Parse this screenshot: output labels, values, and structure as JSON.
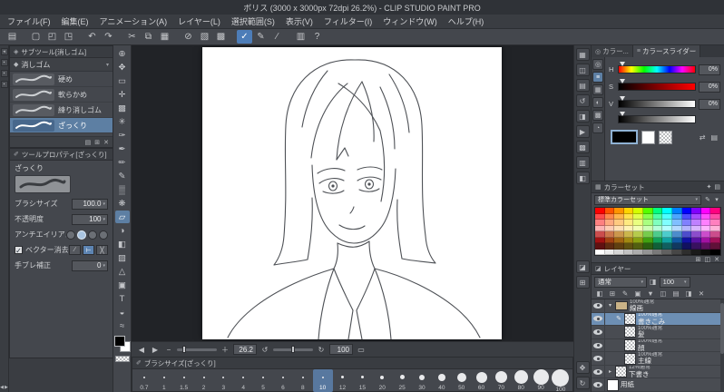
{
  "window": {
    "title": "ボリス (3000 x 3000px 72dpi 26.2%) - CLIP STUDIO PAINT PRO"
  },
  "menu": {
    "items": [
      "ファイル(F)",
      "編集(E)",
      "アニメーション(A)",
      "レイヤー(L)",
      "選択範囲(S)",
      "表示(V)",
      "フィルター(I)",
      "ウィンドウ(W)",
      "ヘルプ(H)"
    ]
  },
  "toolbar": {
    "icons": [
      {
        "name": "panel-layout-icon",
        "glyph": "▤"
      },
      {
        "sep": true
      },
      {
        "name": "new-file-icon",
        "glyph": "▢"
      },
      {
        "name": "open-file-icon",
        "glyph": "◰"
      },
      {
        "name": "save-file-icon",
        "glyph": "◳"
      },
      {
        "sep": true
      },
      {
        "name": "undo-icon",
        "glyph": "↶"
      },
      {
        "name": "redo-icon",
        "glyph": "↷"
      },
      {
        "sep": true
      },
      {
        "name": "cut-icon",
        "glyph": "✂"
      },
      {
        "name": "copy-icon",
        "glyph": "⧉"
      },
      {
        "name": "paste-icon",
        "glyph": "▦"
      },
      {
        "sep": true
      },
      {
        "name": "deselect-icon",
        "glyph": "⊘"
      },
      {
        "name": "invert-selection-icon",
        "glyph": "▧"
      },
      {
        "name": "selection-border-icon",
        "glyph": "▩"
      },
      {
        "sep": true
      },
      {
        "name": "snap-ruler-icon",
        "glyph": "✓",
        "active": true
      },
      {
        "name": "pen-pressure-icon",
        "glyph": "✎"
      },
      {
        "name": "vector-snap-icon",
        "glyph": "∕"
      },
      {
        "sep": true
      },
      {
        "name": "grid-view-icon",
        "glyph": "▥"
      },
      {
        "name": "help-icon",
        "glyph": "?"
      }
    ]
  },
  "left_strip": {
    "icons": [
      {
        "name": "collapse-left-dock-icon",
        "glyph": "◂"
      },
      {
        "name": "workspace-slot-icon-1",
        "glyph": "▪"
      },
      {
        "name": "workspace-slot-icon-2",
        "glyph": "▪"
      },
      {
        "name": "workspace-slot-icon-3",
        "glyph": "▪"
      }
    ],
    "bottom_icons": [
      {
        "name": "scroll-left-icon",
        "glyph": "◀"
      },
      {
        "name": "scroll-right-icon",
        "glyph": "▶"
      }
    ]
  },
  "tools": {
    "fg_color": "#000000",
    "bg_color": "#ffffff",
    "icons": [
      {
        "name": "zoom-tool-icon",
        "glyph": "⊕"
      },
      {
        "name": "move-tool-icon",
        "glyph": "✥"
      },
      {
        "name": "operation-tool-icon",
        "glyph": "▭"
      },
      {
        "name": "layer-move-tool-icon",
        "glyph": "✛"
      },
      {
        "name": "selection-tool-icon",
        "glyph": "▩"
      },
      {
        "name": "auto-select-tool-icon",
        "glyph": "✳"
      },
      {
        "name": "eyedropper-tool-icon",
        "glyph": "✑"
      },
      {
        "name": "pen-tool-icon",
        "glyph": "✒"
      },
      {
        "name": "pencil-tool-icon",
        "glyph": "✏"
      },
      {
        "name": "brush-tool-icon",
        "glyph": "✎"
      },
      {
        "name": "airbrush-tool-icon",
        "glyph": "▒"
      },
      {
        "name": "decoration-tool-icon",
        "glyph": "❋"
      },
      {
        "name": "eraser-tool-icon",
        "glyph": "▱",
        "selected": true
      },
      {
        "name": "blend-tool-icon",
        "glyph": "◑"
      },
      {
        "name": "fill-tool-icon",
        "glyph": "◧"
      },
      {
        "name": "gradient-tool-icon",
        "glyph": "▨"
      },
      {
        "name": "figure-tool-icon",
        "glyph": "△"
      },
      {
        "name": "frame-tool-icon",
        "glyph": "▣"
      },
      {
        "name": "text-tool-icon",
        "glyph": "T"
      },
      {
        "name": "balloon-tool-icon",
        "glyph": "◒"
      },
      {
        "name": "line-correct-tool-icon",
        "glyph": "≈"
      }
    ]
  },
  "subtool": {
    "icon": "◈",
    "title": "サブツール[消しゴム]",
    "group_label": "消しゴム",
    "items": [
      {
        "label": "硬め"
      },
      {
        "label": "軟らかめ"
      },
      {
        "label": "練り消しゴム"
      },
      {
        "label": "ざっくり",
        "selected": true
      }
    ],
    "footer_icons": [
      {
        "name": "subtool-detail-icon",
        "glyph": "▤"
      },
      {
        "name": "add-subtool-icon",
        "glyph": "⊞"
      },
      {
        "name": "delete-subtool-icon",
        "glyph": "✕"
      }
    ]
  },
  "tool_property": {
    "icon": "✐",
    "title": "ツールプロパティ[ざっくり]",
    "subtool_name": "ざっくり",
    "brush_size_label": "ブラシサイズ",
    "brush_size_value": "100.0",
    "opacity_label": "不透明度",
    "opacity_value": "100",
    "antialias_label": "アンチエイリアス",
    "vector_erase_label": "ベクター消去",
    "vector_buttons": [
      {
        "name": "erase-touched-icon",
        "glyph": "∕"
      },
      {
        "name": "erase-intersection-icon",
        "glyph": "⊢",
        "active": true
      },
      {
        "name": "erase-whole-line-icon",
        "glyph": "╳"
      }
    ],
    "stabilize_label": "手ブレ補正",
    "stabilize_value": "0"
  },
  "nav": {
    "items": [
      {
        "name": "flip-prev-icon",
        "glyph": "◀"
      },
      {
        "name": "flip-next-icon",
        "glyph": "▶"
      },
      {
        "name": "zoom-out-icon",
        "glyph": "−"
      },
      {
        "name": "zoom-slider",
        "type": "slider",
        "pos": 0.15
      },
      {
        "name": "zoom-in-icon",
        "glyph": "＋"
      },
      {
        "name": "zoom-value",
        "type": "value",
        "value": "26.2"
      },
      {
        "name": "rotate-left-icon",
        "glyph": "↺"
      },
      {
        "name": "rotate-slider",
        "type": "slider",
        "pos": 0.5
      },
      {
        "name": "rotate-right-icon",
        "glyph": "↻"
      },
      {
        "name": "rotation-value",
        "type": "value",
        "value": "100"
      },
      {
        "name": "reset-view-icon",
        "glyph": "▭"
      }
    ]
  },
  "brush_size_panel": {
    "icon": "✐",
    "title": "ブラシサイズ[ざっくり]",
    "sizes": [
      0.7,
      1,
      1.5,
      2,
      3,
      4,
      5,
      6,
      8,
      10,
      12,
      15,
      20,
      25,
      30,
      40,
      50,
      60,
      70,
      80,
      90,
      100
    ],
    "selected": 10
  },
  "right_dock": {
    "top_icons": [
      {
        "name": "navigator-panel-icon",
        "glyph": "▦"
      },
      {
        "name": "subview-panel-icon",
        "glyph": "◫"
      },
      {
        "name": "info-panel-icon",
        "glyph": "▤"
      },
      {
        "name": "history-panel-icon",
        "glyph": "↺"
      },
      {
        "name": "material-panel-icon",
        "glyph": "◨"
      },
      {
        "name": "auto-action-panel-icon",
        "glyph": "▶"
      },
      {
        "name": "tone-scale-panel-icon",
        "glyph": "▩"
      },
      {
        "name": "overflow-panel-icon",
        "glyph": "▥"
      },
      {
        "name": "timeline-panel-icon",
        "glyph": "◧"
      }
    ],
    "mid_icons": [
      {
        "name": "layer-property-panel-icon",
        "glyph": "◪"
      },
      {
        "name": "layer-search-panel-icon",
        "glyph": "⊞"
      }
    ],
    "bottom_icons": [
      {
        "name": "grab-view-icon",
        "glyph": "✥"
      },
      {
        "name": "rotate-view-icon",
        "glyph": "↻"
      }
    ]
  },
  "color_panel": {
    "tab_color_icon": "◎",
    "tab_color": "カラー...",
    "tab_slider_icon": "≡",
    "tab_slider": "カラースライダー",
    "mini_icons": [
      {
        "name": "color-wheel-icon",
        "glyph": "◎"
      },
      {
        "name": "color-slider-icon",
        "glyph": "≡",
        "active": true
      },
      {
        "name": "color-set-mini-icon",
        "glyph": "▦"
      },
      {
        "name": "intermediate-color-icon",
        "glyph": "◐"
      },
      {
        "name": "approximate-color-icon",
        "glyph": "▩"
      },
      {
        "name": "color-history-icon",
        "glyph": "◔"
      }
    ],
    "sliders": [
      {
        "label": "H",
        "value": "0%",
        "type": "hue"
      },
      {
        "label": "S",
        "value": "0%",
        "type": "sat"
      },
      {
        "label": "V",
        "value": "0%",
        "type": "val"
      }
    ],
    "main_color": "#000000",
    "sub_color": "#ffffff",
    "swatch_icons": [
      {
        "name": "switch-colors-icon",
        "glyph": "⇄"
      },
      {
        "name": "color-panel-menu-icon",
        "glyph": "▤"
      }
    ]
  },
  "color_set": {
    "icon": "▦",
    "title": "カラーセット",
    "header_icons": [
      {
        "name": "colorset-wrench-icon",
        "glyph": "✦"
      },
      {
        "name": "colorset-menu-icon",
        "glyph": "▤"
      }
    ],
    "selected_set": "標準カラーセット",
    "dropdown_icons": [
      {
        "name": "edit-colorset-icon",
        "glyph": "✎"
      },
      {
        "name": "colorset-list-icon",
        "glyph": "▾"
      }
    ],
    "palette": {
      "hues": [
        0,
        20,
        35,
        50,
        70,
        100,
        150,
        180,
        210,
        240,
        270,
        300,
        330
      ],
      "tone_rows": [
        [
          100,
          50
        ],
        [
          100,
          65
        ],
        [
          100,
          75
        ],
        [
          100,
          85
        ],
        [
          55,
          55
        ],
        [
          80,
          35
        ],
        [
          70,
          22
        ]
      ],
      "gray_levels": [
        100,
        92,
        84,
        76,
        68,
        58,
        48,
        38,
        28,
        18,
        10,
        5,
        0
      ]
    },
    "footer_icons": [
      {
        "name": "add-color-icon",
        "glyph": "⊞"
      },
      {
        "name": "replace-color-icon",
        "glyph": "◫"
      },
      {
        "name": "delete-color-icon",
        "glyph": "✕"
      }
    ]
  },
  "layers": {
    "icon": "◪",
    "title": "レイヤー",
    "blend_mode": "通常",
    "opacity_icon": "◨",
    "opacity_value": "100",
    "effect_icons": [
      {
        "name": "clip-to-layer-icon",
        "glyph": "◧"
      },
      {
        "name": "new-raster-layer-icon",
        "glyph": "⊞"
      },
      {
        "name": "new-vector-layer-icon",
        "glyph": "✎"
      },
      {
        "name": "new-folder-icon",
        "glyph": "▣"
      },
      {
        "name": "merge-down-icon",
        "glyph": "▼"
      },
      {
        "name": "layer-mask-icon",
        "glyph": "◫"
      },
      {
        "name": "apply-mask-icon",
        "glyph": "▤"
      },
      {
        "name": "two-pane-icon",
        "glyph": "◨"
      },
      {
        "name": "delete-layer-icon",
        "glyph": "✕"
      }
    ],
    "items": [
      {
        "kind": "folder",
        "thumb": "folder",
        "mode": "100%通常",
        "name": "線画",
        "expanded": true,
        "indent": 0
      },
      {
        "kind": "layer",
        "thumb": "checker",
        "mode": "100%通常",
        "name": "書きこみ",
        "selected": true,
        "indent": 1,
        "editing": true
      },
      {
        "kind": "layer",
        "thumb": "checker",
        "mode": "100%通常",
        "name": "髪",
        "indent": 1
      },
      {
        "kind": "layer",
        "thumb": "checker",
        "mode": "100%通常",
        "name": "顔",
        "indent": 1
      },
      {
        "kind": "layer",
        "thumb": "checker",
        "mode": "100%通常",
        "name": "主線",
        "indent": 1
      },
      {
        "kind": "folder",
        "thumb": "checker",
        "mode": "12%通常",
        "name": "下書き",
        "expanded": false,
        "indent": 0
      },
      {
        "kind": "paper",
        "thumb": "paper",
        "name": "用紙",
        "indent": 0
      }
    ]
  }
}
